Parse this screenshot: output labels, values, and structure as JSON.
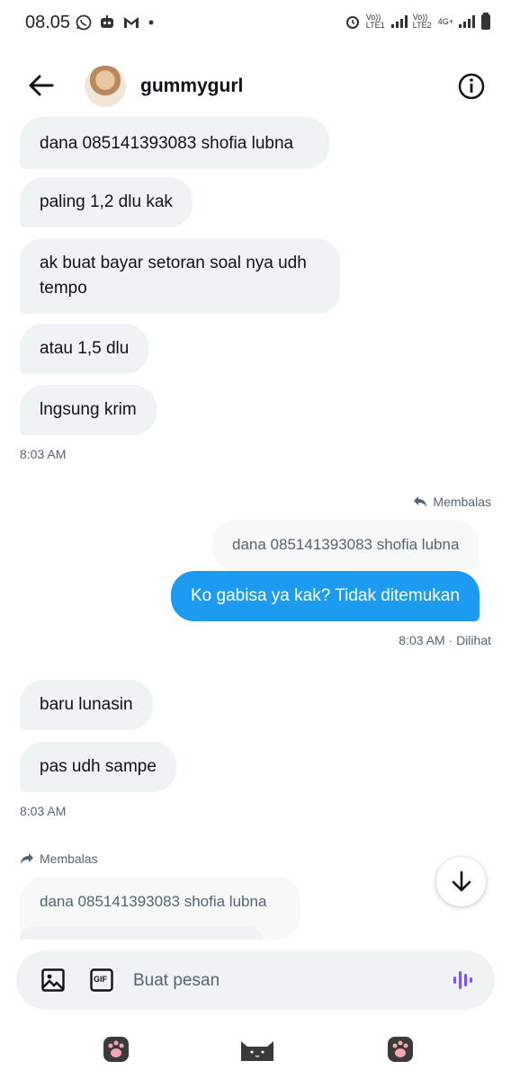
{
  "status_bar": {
    "time": "08.05",
    "sim1_label": "Vo)) LTE1",
    "sim2_label": "Vo)) LTE2",
    "network": "4G+"
  },
  "header": {
    "username": "gummygurl",
    "back_icon": "arrow-left-icon",
    "info_icon": "info-icon"
  },
  "conversation": {
    "group1": [
      {
        "text": "dana 085141393083 shofia lubna"
      },
      {
        "text": "paling 1,2 dlu kak"
      },
      {
        "text": "ak buat bayar setoran soal nya udh tempo"
      },
      {
        "text": "atau 1,5 dlu"
      },
      {
        "text": "lngsung krim"
      }
    ],
    "group1_time": "8:03 AM",
    "outgoing_reply_label": "Membalas",
    "outgoing_quoted": "dana 085141393083 shofia lubna",
    "outgoing_text": "Ko gabisa ya kak? Tidak ditemukan",
    "outgoing_time": "8:03 AM · Dilihat",
    "group2": [
      {
        "text": "baru lunasin"
      },
      {
        "text": "pas udh sampe"
      }
    ],
    "group2_time": "8:03 AM",
    "incoming_reply_label": "Membalas",
    "incoming_quoted": "dana 085141393083 shofia lubna"
  },
  "composer": {
    "placeholder": "Buat pesan",
    "gif_label": "GIF"
  },
  "colors": {
    "accent": "#1d9bf0",
    "incoming_bubble": "#eff3f4",
    "voice_icon": "#7856ff"
  }
}
